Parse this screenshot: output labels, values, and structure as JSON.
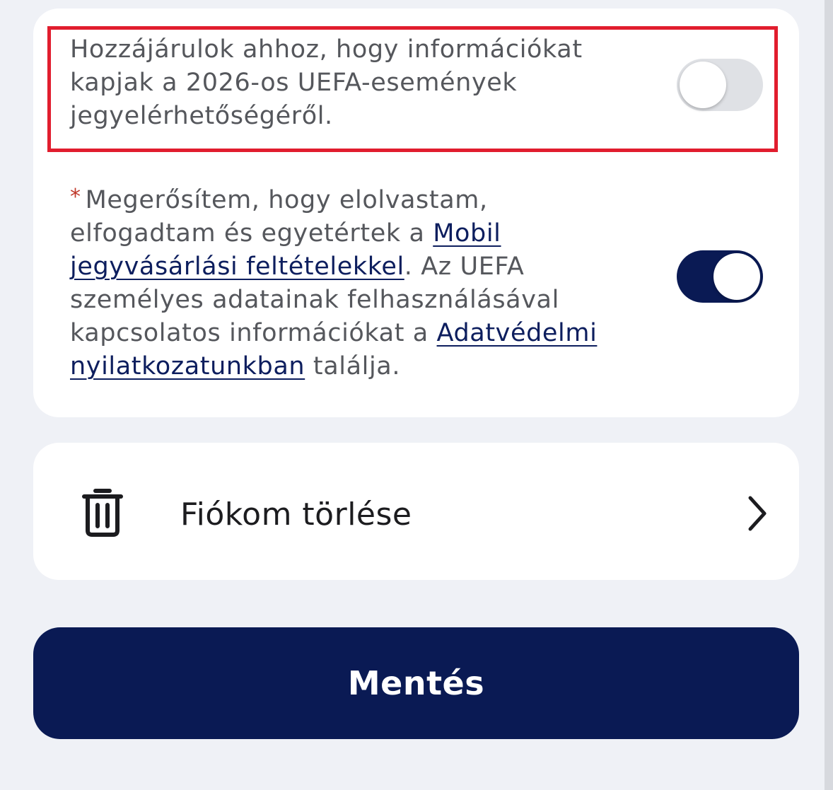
{
  "consent_card": {
    "uefa_events": {
      "text": "Hozzájárulok ahhoz, hogy információkat kapjak a 2026-os UEFA-események jegyelérhetőségéről.",
      "toggle_on": false
    },
    "terms": {
      "asterisk": "*",
      "text_before": "Megerősítem, hogy elolvastam, elfogadtam és egyetértek a ",
      "link_terms": "Mobil jegyvásárlási feltételekkel",
      "text_middle": ". Az UEFA személyes adatainak felhasználásával kapcsolatos információkat a ",
      "link_privacy": "Adatvédelmi nyilatkozatunkban",
      "text_after": " találja.",
      "toggle_on": true
    }
  },
  "delete_account": {
    "label": "Fiókom törlése",
    "icon": "trash-icon",
    "chevron_icon": "chevron-right-icon"
  },
  "save_button": {
    "label": "Mentés"
  },
  "colors": {
    "background": "#eff1f6",
    "primary": "#0a1a54",
    "highlight": "#e11d2e",
    "toggle_off": "#dfe1e5"
  }
}
